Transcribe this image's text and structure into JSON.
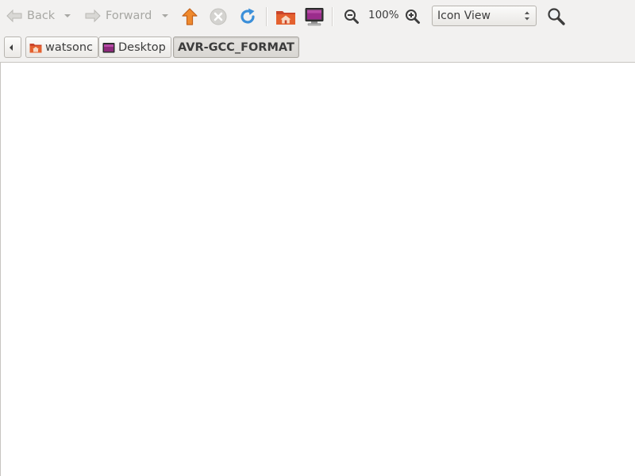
{
  "toolbar": {
    "back_label": "Back",
    "forward_label": "Forward",
    "zoom_level": "100%",
    "view_mode": "Icon View"
  },
  "icons": {
    "back": "arrow-left-icon",
    "back_dropdown": "chevron-down-icon",
    "forward": "arrow-right-icon",
    "forward_dropdown": "chevron-down-icon",
    "up": "arrow-up-icon",
    "stop": "stop-icon",
    "reload": "reload-icon",
    "home": "home-folder-icon",
    "computer": "computer-icon",
    "zoom_out": "zoom-out-icon",
    "zoom_in": "zoom-in-icon",
    "search": "search-icon"
  },
  "pathbar": {
    "crumbs": [
      {
        "label": "watsonc",
        "icon": "home-folder-icon"
      },
      {
        "label": "Desktop",
        "icon": "desktop-folder-icon"
      },
      {
        "label": "AVR-GCC_FORMAT",
        "active": true
      }
    ]
  },
  "colors": {
    "toolbar_bg": "#f2f1f0",
    "content_bg": "#ffffff",
    "up_arrow": "#e57b24",
    "reload": "#3b8fd9",
    "home_folder": "#d9531e",
    "desktop_folder": "#8d2a7c"
  }
}
